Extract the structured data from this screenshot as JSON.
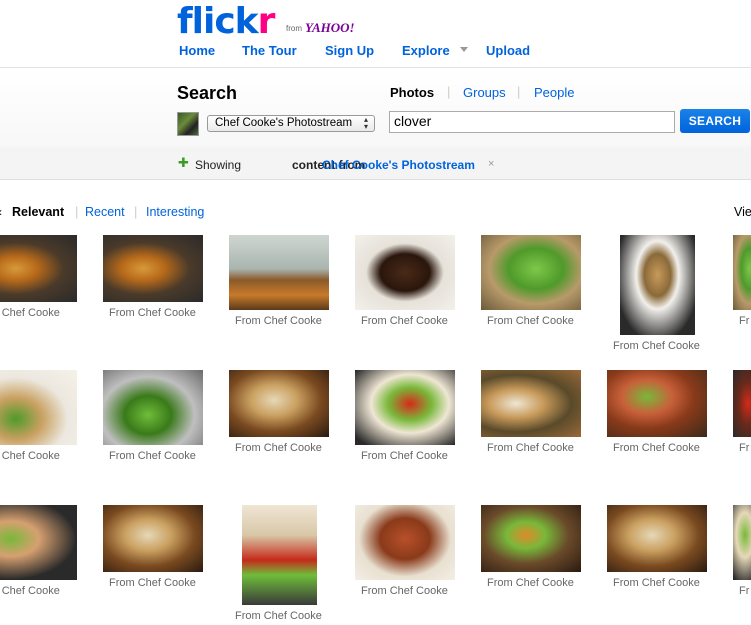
{
  "header": {
    "logo_part1": "flick",
    "logo_part2": "r",
    "from": "from",
    "yahoo": "YAHOO!",
    "nav": [
      "Home",
      "The Tour",
      "Sign Up",
      "Explore",
      "Upload"
    ]
  },
  "search": {
    "title": "Search",
    "tabs": [
      "Photos",
      "Groups",
      "People"
    ],
    "scope": "Chef Cooke's Photostream",
    "query": "clover",
    "button": "SEARCH"
  },
  "showing": {
    "prefix": "Showing",
    "middle": "content from",
    "link": "Chef Cooke's Photostream",
    "close": "×"
  },
  "sort": {
    "options": [
      "Relevant",
      "Recent",
      "Interesting"
    ],
    "view": "Vie"
  },
  "colors": {
    "brand_blue": "#0063dc",
    "brand_pink": "#ff0084",
    "yahoo_purple": "#7b0099"
  },
  "photos": [
    {
      "caption": "From Chef Cooke",
      "thumb": "fries-wrap"
    },
    {
      "caption": "From Chef Cooke",
      "thumb": "fries-wrap"
    },
    {
      "caption": "From Chef Cooke",
      "thumb": "fries-plate"
    },
    {
      "caption": "From Chef Cooke",
      "thumb": "chicken"
    },
    {
      "caption": "From Chef Cooke",
      "thumb": "greens"
    },
    {
      "caption": "From Chef Cooke",
      "thumb": "soup-cup"
    },
    {
      "caption": "Fr",
      "thumb": "greens"
    },
    {
      "caption": "From Chef Cooke",
      "thumb": "chalkboard-wrap"
    },
    {
      "caption": "From Chef Cooke",
      "thumb": "street-wrap"
    },
    {
      "caption": "From Chef Cooke",
      "thumb": "pita-fries"
    },
    {
      "caption": "From Chef Cooke",
      "thumb": "pita-tomato"
    },
    {
      "caption": "From Chef Cooke",
      "thumb": "pita-drink"
    },
    {
      "caption": "From Chef Cooke",
      "thumb": "pita-cutlets"
    },
    {
      "caption": "Fr",
      "thumb": "tomato"
    },
    {
      "caption": "From Chef Cooke",
      "thumb": "hand-wrap"
    },
    {
      "caption": "From Chef Cooke",
      "thumb": "pita-fries"
    },
    {
      "caption": "From Chef Cooke",
      "thumb": "pita-tomato-tall"
    },
    {
      "caption": "From Chef Cooke",
      "thumb": "sweet-fries"
    },
    {
      "caption": "From Chef Cooke",
      "thumb": "curry-pita"
    },
    {
      "caption": "From Chef Cooke",
      "thumb": "pita-fries"
    },
    {
      "caption": "Fr",
      "thumb": "pita-greens"
    }
  ]
}
